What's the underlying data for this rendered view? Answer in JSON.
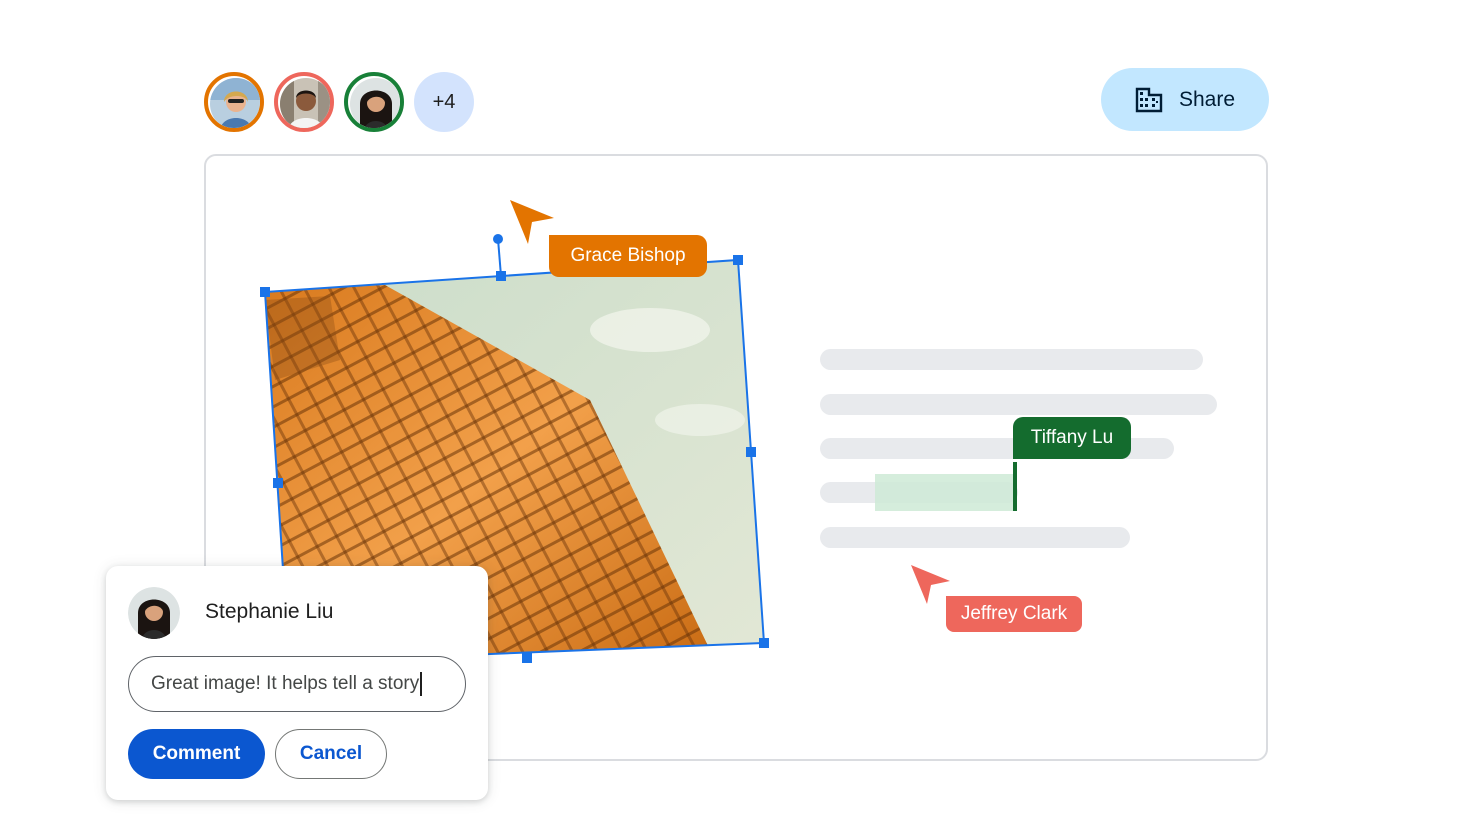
{
  "collaborators": {
    "avatars": [
      {
        "name": "avatar-1",
        "ring_color": "#e37400"
      },
      {
        "name": "avatar-2",
        "ring_color": "#ee675c"
      },
      {
        "name": "avatar-3",
        "ring_color": "#188038"
      }
    ],
    "more_count_label": "+4"
  },
  "share": {
    "label": "Share",
    "icon": "building-icon"
  },
  "cursors": {
    "grace": {
      "name": "Grace Bishop",
      "color": "#e37400"
    },
    "tiffany": {
      "name": "Tiffany Lu",
      "color": "#146c2e"
    },
    "jeffrey": {
      "name": "Jeffrey Clark",
      "color": "#ee675c"
    }
  },
  "comment": {
    "author": "Stephanie Liu",
    "input_value": "Great image! It helps tell a story",
    "submit_label": "Comment",
    "cancel_label": "Cancel"
  },
  "colors": {
    "selection_blue": "#1a73e8",
    "text_placeholder": "#e8eaed",
    "highlight": "#ceead6"
  }
}
